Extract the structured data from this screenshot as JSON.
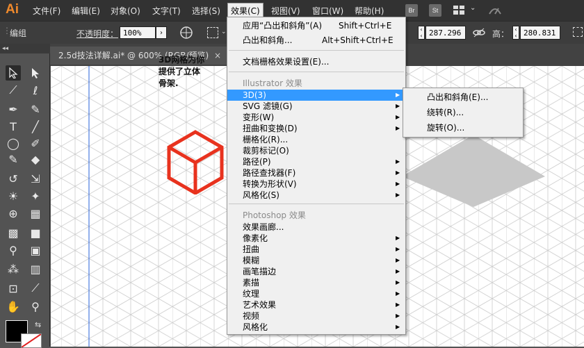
{
  "app": {
    "logo": "Ai"
  },
  "menubar": {
    "items": [
      "文件(F)",
      "编辑(E)",
      "对象(O)",
      "文字(T)",
      "选择(S)",
      "效果(C)",
      "视图(V)",
      "窗口(W)",
      "帮助(H)"
    ],
    "right_icons": [
      "Br",
      "St"
    ]
  },
  "control_bar": {
    "selection": "编组",
    "opacity_label": "不透明度：",
    "opacity_value": "100%",
    "width_value": "287.296",
    "height_label": "高：",
    "height_value": "280.831"
  },
  "document_tab": {
    "title": "2.5d技法详解.ai* @ 600% (RGB/预览)",
    "close": "×"
  },
  "toolbar": {
    "collapse": "◂◂"
  },
  "canvas": {
    "text_lines": [
      "3D网格为你",
      "提供了立体",
      "骨架."
    ]
  },
  "effect_menu": {
    "top_items": [
      {
        "label": "应用“凸出和斜角”(A)",
        "shortcut": "Shift+Ctrl+E"
      },
      {
        "label": "凸出和斜角...",
        "shortcut": "Alt+Shift+Ctrl+E"
      }
    ],
    "raster_settings": "文档栅格效果设置(E)...",
    "illustrator_header": "Illustrator 效果",
    "illustrator_items": [
      {
        "label": "3D(3)",
        "submenu": true
      },
      {
        "label": "SVG 滤镜(G)",
        "submenu": true
      },
      {
        "label": "变形(W)",
        "submenu": true
      },
      {
        "label": "扭曲和变换(D)",
        "submenu": true
      },
      {
        "label": "栅格化(R)...",
        "submenu": false
      },
      {
        "label": "裁剪标记(O)",
        "submenu": false
      },
      {
        "label": "路径(P)",
        "submenu": true
      },
      {
        "label": "路径查找器(F)",
        "submenu": true
      },
      {
        "label": "转换为形状(V)",
        "submenu": true
      },
      {
        "label": "风格化(S)",
        "submenu": true
      }
    ],
    "photoshop_header": "Photoshop 效果",
    "photoshop_items": [
      {
        "label": "效果画廊...",
        "submenu": false
      },
      {
        "label": "像素化",
        "submenu": true
      },
      {
        "label": "扭曲",
        "submenu": true
      },
      {
        "label": "模糊",
        "submenu": true
      },
      {
        "label": "画笔描边",
        "submenu": true
      },
      {
        "label": "素描",
        "submenu": true
      },
      {
        "label": "纹理",
        "submenu": true
      },
      {
        "label": "艺术效果",
        "submenu": true
      },
      {
        "label": "视频",
        "submenu": true
      },
      {
        "label": "风格化",
        "submenu": true
      }
    ]
  },
  "submenu_3d": {
    "items": [
      "凸出和斜角(E)...",
      "绕转(R)...",
      "旋转(O)..."
    ]
  },
  "colors": {
    "accent": "#3399ff",
    "cube": "#e8321e",
    "diamond": "#c8c8c8",
    "guide": "#4a7be0"
  }
}
